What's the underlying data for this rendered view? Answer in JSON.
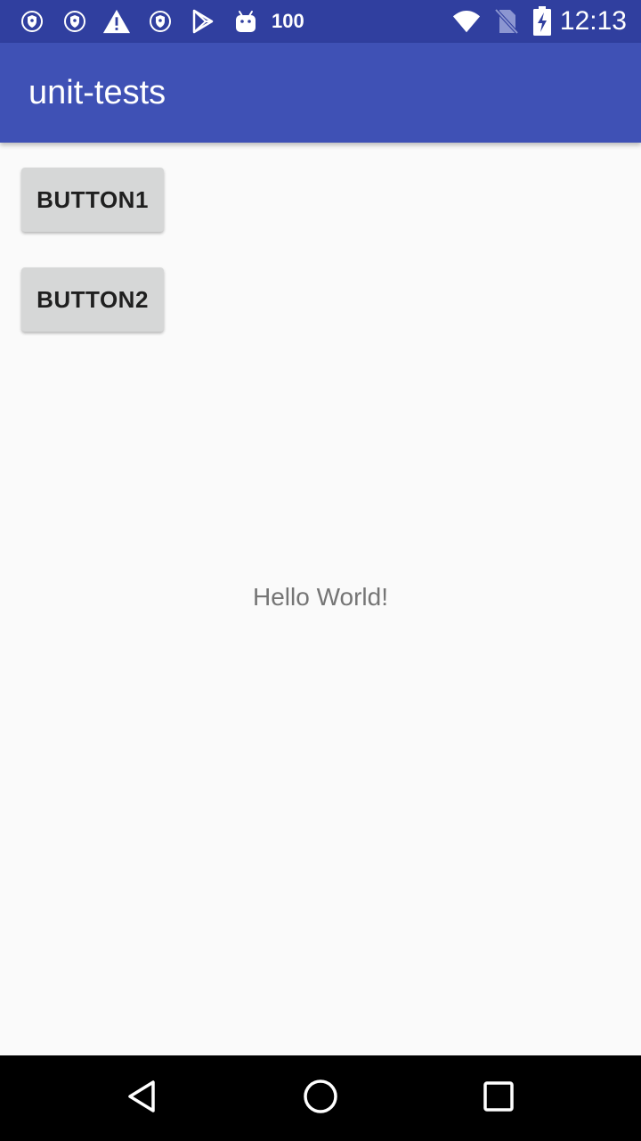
{
  "status_bar": {
    "notification_icons": [
      "shield-icon",
      "shield-icon",
      "warning-icon",
      "shield-icon",
      "play-store-icon",
      "android-icon"
    ],
    "battery_text": "100",
    "clock": "12:13",
    "system_icons": [
      "wifi-icon",
      "no-sim-icon",
      "battery-charging-icon"
    ],
    "background_color": "#303f9f"
  },
  "app_bar": {
    "title": "unit-tests",
    "background_color": "#3f51b5"
  },
  "content": {
    "button1_label": "BUTTON1",
    "button2_label": "BUTTON2",
    "message": "Hello World!"
  },
  "nav_bar": {
    "buttons": [
      "back-icon",
      "home-icon",
      "recents-icon"
    ]
  }
}
